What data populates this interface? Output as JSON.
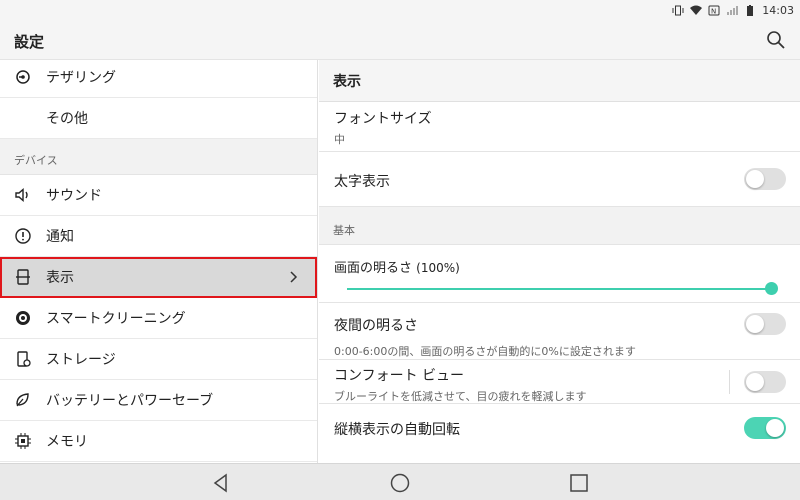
{
  "status_bar": {
    "time": "14:03"
  },
  "app_bar": {
    "title": "設定"
  },
  "left_panel": {
    "items_top": [
      {
        "label": "テザリング",
        "icon": "tethering-icon"
      },
      {
        "label": "その他",
        "icon": ""
      }
    ],
    "section_device": "デバイス",
    "items_device": [
      {
        "label": "サウンド",
        "icon": "sound-icon"
      },
      {
        "label": "通知",
        "icon": "notification-icon"
      },
      {
        "label": "表示",
        "icon": "display-icon"
      },
      {
        "label": "スマートクリーニング",
        "icon": "smart-cleaning-icon"
      },
      {
        "label": "ストレージ",
        "icon": "storage-icon"
      },
      {
        "label": "バッテリーとパワーセーブ",
        "icon": "battery-icon"
      },
      {
        "label": "メモリ",
        "icon": "memory-icon"
      }
    ]
  },
  "right_panel": {
    "header": "表示",
    "font_size": {
      "title": "フォントサイズ",
      "value": "中"
    },
    "bold": {
      "title": "太字表示",
      "enabled": false
    },
    "section_basic": "基本",
    "brightness": {
      "title": "画面の明るさ",
      "value_text": "(100%)",
      "level": 1.0
    },
    "night_brightness": {
      "title": "夜間の明るさ",
      "description": "0:00-6:00の間、画面の明るさが自動的に0%に設定されます",
      "enabled": false
    },
    "comfort_view": {
      "title": "コンフォート ビュー",
      "description": "ブルーライトを低減させて、目の疲れを軽減します",
      "enabled": false
    },
    "auto_rotate": {
      "title": "縦横表示の自動回転",
      "enabled": true
    }
  },
  "colors": {
    "accent": "#3ecfae",
    "selection_outline": "#e0161b"
  }
}
